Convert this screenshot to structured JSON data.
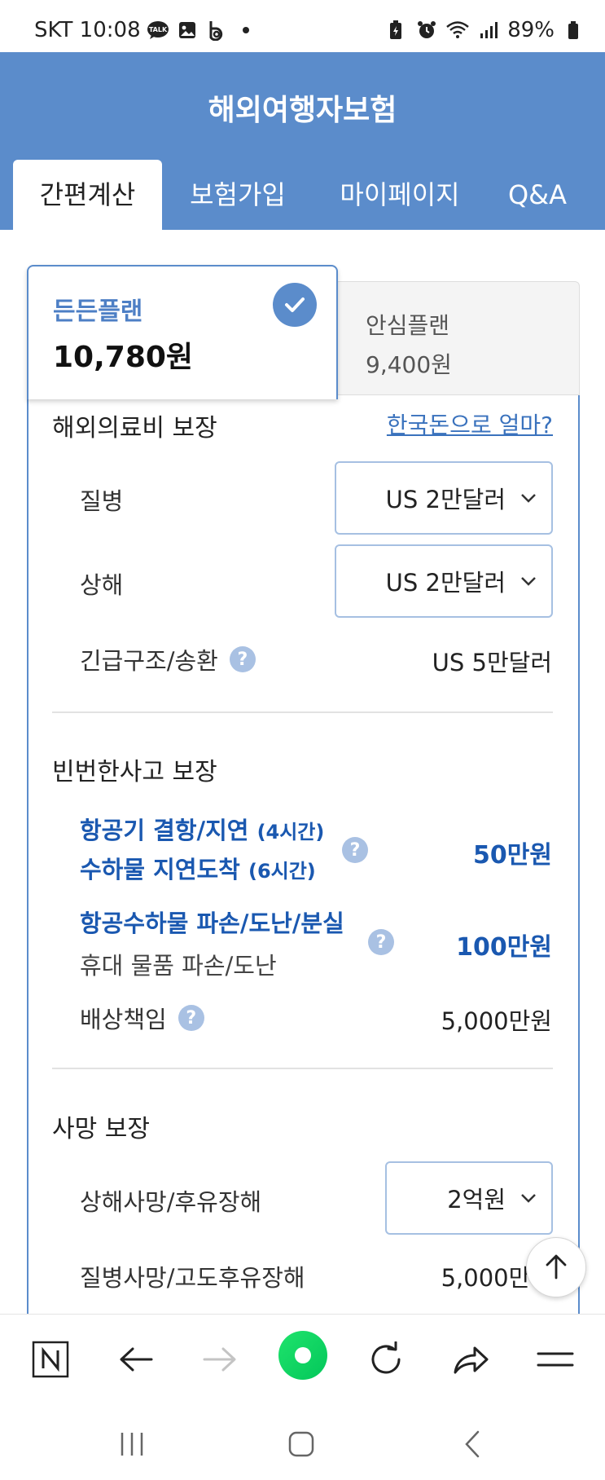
{
  "status_bar": {
    "carrier_time": "SKT 10:08",
    "battery": "89%",
    "icons": [
      "talk-icon",
      "gallery-icon",
      "b-app-icon",
      "dot-icon",
      "battery-saver-icon",
      "alarm-icon",
      "wifi-icon",
      "signal-icon",
      "battery-icon"
    ]
  },
  "header": {
    "title": "해외여행자보험",
    "tabs": [
      {
        "label": "간편계산",
        "active": true
      },
      {
        "label": "보험가입",
        "active": false
      },
      {
        "label": "마이페이지",
        "active": false
      },
      {
        "label": "Q&A",
        "active": false
      }
    ]
  },
  "plans": {
    "selected": {
      "name": "든든플랜",
      "price": "10,780원"
    },
    "other": {
      "name": "안심플랜",
      "price": "9,400원"
    }
  },
  "medical": {
    "title": "해외의료비 보장",
    "link": "한국돈으로 얼마?",
    "illness": {
      "label": "질병",
      "value": "US 2만달러"
    },
    "injury": {
      "label": "상해",
      "value": "US 2만달러"
    },
    "rescue": {
      "label": "긴급구조/송환",
      "value": "US 5만달러"
    }
  },
  "frequent": {
    "title": "빈번한사고 보장",
    "flight_delay": {
      "line1": "항공기 결항/지연",
      "line1_note": "(4시간)",
      "line2": "수하물 지연도착",
      "line2_note": "(6시간)",
      "value": "50만원"
    },
    "baggage": {
      "line1": "항공수하물 파손/도난/분실",
      "line2": "휴대 물품 파손/도난",
      "value": "100만원"
    },
    "liability": {
      "label": "배상책임",
      "value": "5,000만원"
    }
  },
  "death": {
    "title": "사망 보장",
    "injury_death": {
      "label": "상해사망/후유장해",
      "value": "2억원"
    },
    "illness_death": {
      "label": "질병사망/고도후유장해",
      "value": "5,000만원"
    }
  },
  "help_glyph": "?",
  "colors": {
    "brand": "#5b8ccb",
    "link": "#3a72bd",
    "emphasis": "#1a58b0"
  }
}
